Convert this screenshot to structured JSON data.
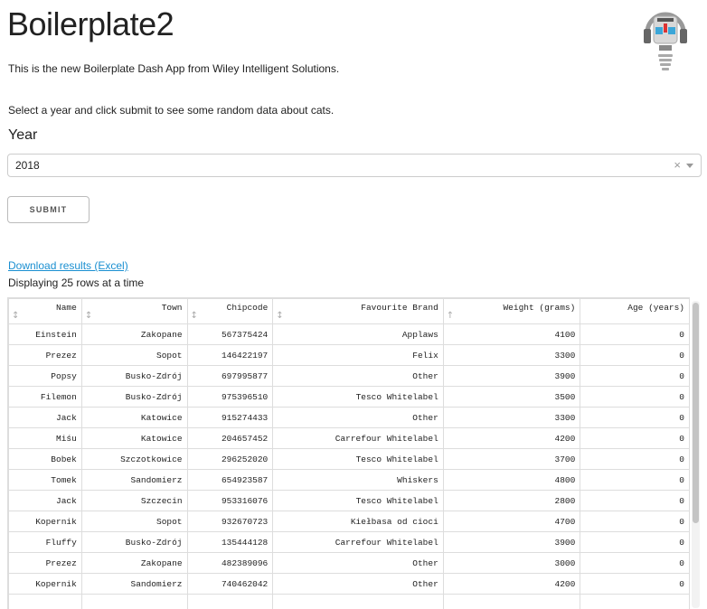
{
  "header": {
    "title": "Boilerplate2",
    "intro": "This is the new Boilerplate Dash App from Wiley Intelligent Solutions.",
    "logo_icon": "robot-lightbulb-icon"
  },
  "form": {
    "instruction": "Select a year and click submit to see some random data about cats.",
    "year_label": "Year",
    "year_value": "2018",
    "clear_symbol": "×",
    "submit_label": "SUBMIT"
  },
  "results": {
    "download_label": "Download results (Excel)",
    "paging_text": "Displaying 25 rows at a time"
  },
  "table": {
    "columns": [
      "Name",
      "Town",
      "Chipcode",
      "Favourite Brand",
      "Weight (grams)",
      "Age (years)"
    ],
    "sort_icons": [
      "↕",
      "↕",
      "↕",
      "↕",
      "↑",
      ""
    ],
    "rows": [
      [
        "Einstein",
        "Zakopane",
        "567375424",
        "Applaws",
        "4100",
        "0"
      ],
      [
        "Prezez",
        "Sopot",
        "146422197",
        "Felix",
        "3300",
        "0"
      ],
      [
        "Popsy",
        "Busko-Zdrój",
        "697995877",
        "Other",
        "3900",
        "0"
      ],
      [
        "Filemon",
        "Busko-Zdrój",
        "975396510",
        "Tesco Whitelabel",
        "3500",
        "0"
      ],
      [
        "Jack",
        "Katowice",
        "915274433",
        "Other",
        "3300",
        "0"
      ],
      [
        "Miśu",
        "Katowice",
        "204657452",
        "Carrefour Whitelabel",
        "4200",
        "0"
      ],
      [
        "Bobek",
        "Szczotkowice",
        "296252020",
        "Tesco Whitelabel",
        "3700",
        "0"
      ],
      [
        "Tomek",
        "Sandomierz",
        "654923587",
        "Whiskers",
        "4800",
        "0"
      ],
      [
        "Jack",
        "Szczecin",
        "953316076",
        "Tesco Whitelabel",
        "2800",
        "0"
      ],
      [
        "Kopernik",
        "Sopot",
        "932670723",
        "Kiełbasa od cioci",
        "4700",
        "0"
      ],
      [
        "Fluffy",
        "Busko-Zdrój",
        "135444128",
        "Carrefour Whitelabel",
        "3900",
        "0"
      ],
      [
        "Prezez",
        "Zakopane",
        "482389096",
        "Other",
        "3000",
        "0"
      ],
      [
        "Kopernik",
        "Sandomierz",
        "740462042",
        "Other",
        "4200",
        "0"
      ],
      [
        "",
        "",
        "",
        "",
        "",
        ""
      ]
    ]
  }
}
